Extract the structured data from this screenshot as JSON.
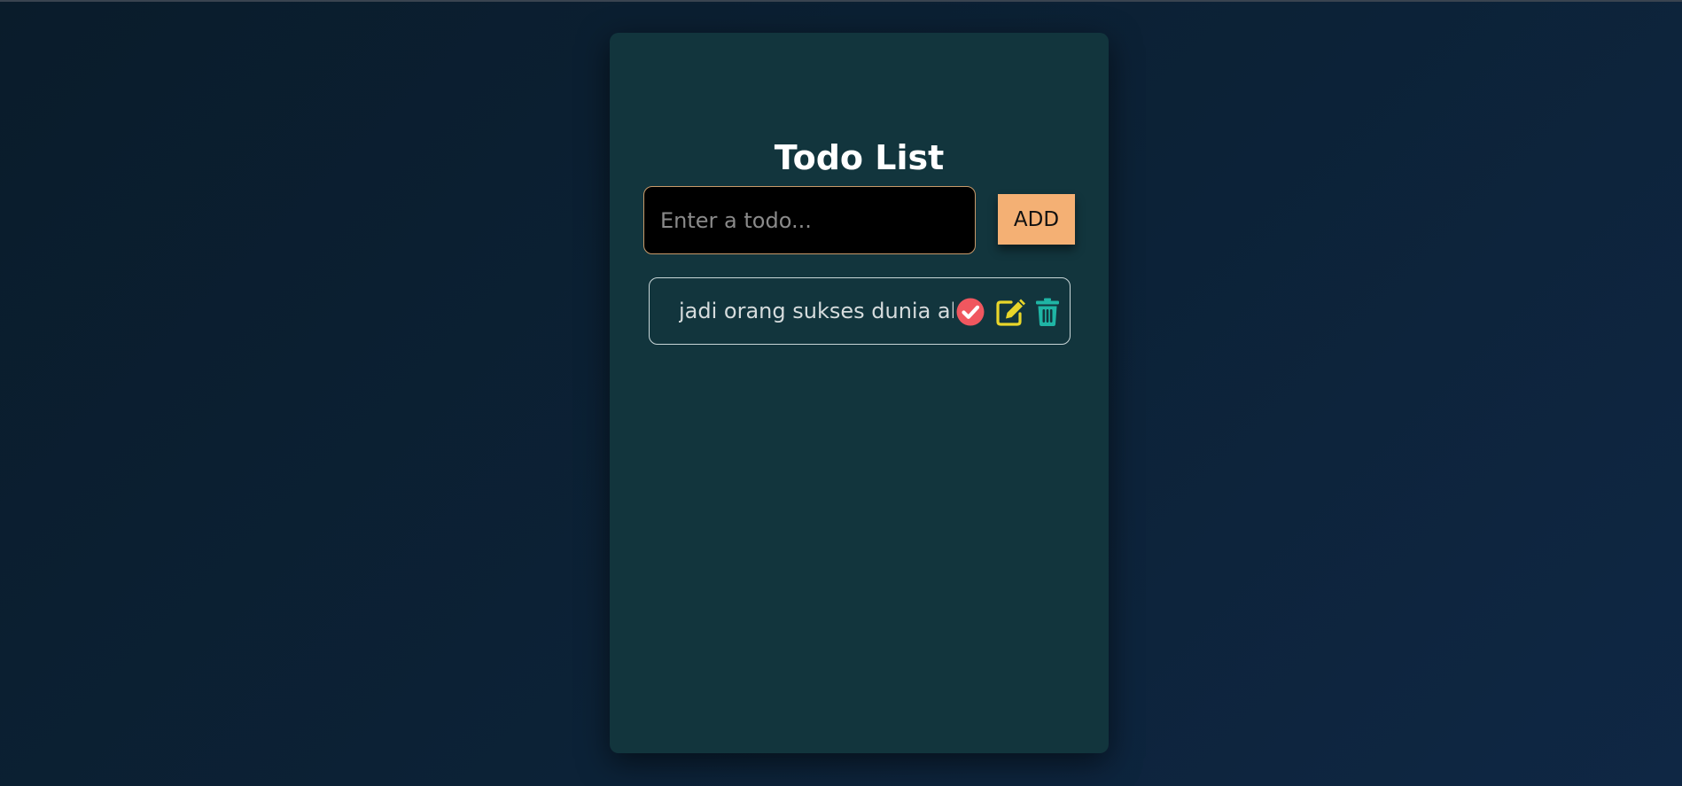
{
  "app": {
    "title": "Todo List"
  },
  "input": {
    "placeholder": "Enter a todo...",
    "value": ""
  },
  "add_button": {
    "label": "ADD"
  },
  "todos": [
    {
      "text": "jadi orang sukses dunia akhirat",
      "actions": [
        "check-circle-icon",
        "edit-icon",
        "trash-icon"
      ]
    }
  ],
  "colors": {
    "background": "#0c2237",
    "card": "#12353d",
    "input_bg": "#000000",
    "input_border": "#c89a6a",
    "add_button": "#f4b074",
    "check_icon": "#f0575f",
    "edit_icon": "#e9d62a",
    "trash_icon": "#1fb5a5",
    "todo_border": "#c9d6d8"
  }
}
